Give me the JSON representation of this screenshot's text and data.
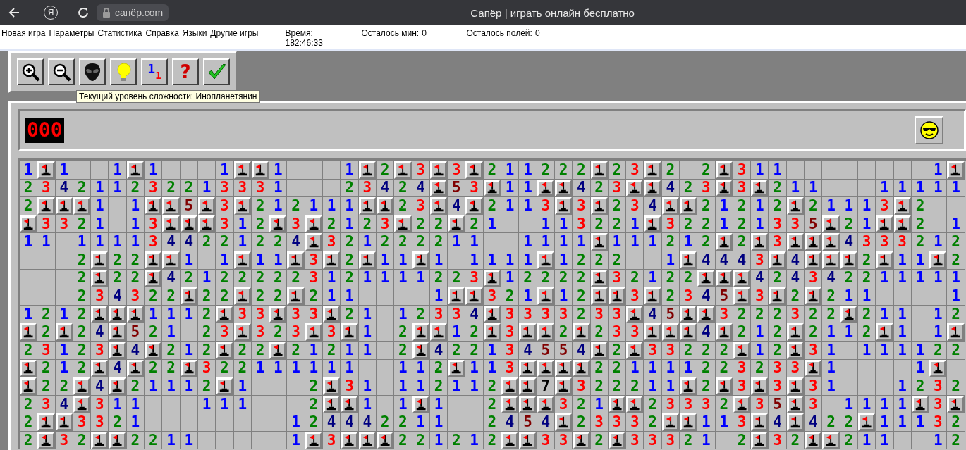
{
  "browser": {
    "logo": "Я",
    "address": "сапёр.com",
    "title": "Сапёр | играть онлайн бесплатно"
  },
  "menu": [
    "Новая игра",
    "Параметры",
    "Статистика",
    "Справка",
    "Языки",
    "Другие игры"
  ],
  "status": [
    {
      "label": "Время:",
      "value": "182:46:33"
    },
    {
      "label": "Осталось мин:",
      "value": "0"
    },
    {
      "label": "Осталось полей:",
      "value": "0"
    }
  ],
  "toolbar": [
    {
      "kind": "zoom-in"
    },
    {
      "kind": "zoom-out"
    },
    {
      "kind": "alien"
    },
    {
      "kind": "bulb"
    },
    {
      "kind": "numbers",
      "glyphs": [
        "1",
        "1"
      ]
    },
    {
      "kind": "help",
      "glyph": "?"
    },
    {
      "kind": "check"
    }
  ],
  "tooltip": "Текущий уровень сложности: Инопланетянин",
  "game": {
    "mine_counter": "000",
    "face": {
      "kind": "sunglasses"
    },
    "rows": [
      [
        "1",
        {
          "kind": "flag"
        },
        "1",
        {
          "kind": "open"
        },
        {
          "kind": "open"
        },
        "1",
        {
          "kind": "flag"
        },
        "1",
        {
          "kind": "open"
        },
        {
          "kind": "open"
        },
        {
          "kind": "open"
        },
        "1",
        {
          "kind": "flag"
        },
        {
          "kind": "flag"
        },
        "1",
        {
          "kind": "open"
        },
        {
          "kind": "open"
        },
        {
          "kind": "open"
        },
        "1",
        {
          "kind": "flag"
        },
        "2",
        {
          "kind": "flag"
        },
        "3",
        {
          "kind": "flag"
        },
        "3",
        {
          "kind": "flag"
        },
        "2",
        "1",
        "1",
        "2",
        "2",
        "2",
        {
          "kind": "flag"
        },
        "2",
        "3",
        {
          "kind": "flag"
        },
        "2",
        {
          "kind": "open"
        },
        "2",
        {
          "kind": "flag"
        },
        "3",
        "1",
        "1",
        {
          "kind": "open"
        },
        {
          "kind": "open"
        },
        {
          "kind": "open"
        },
        {
          "kind": "open"
        },
        {
          "kind": "open"
        },
        {
          "kind": "open"
        },
        {
          "kind": "open"
        },
        {
          "kind": "open"
        },
        "1",
        {
          "kind": "flag"
        }
      ],
      [
        "2",
        "3",
        "4",
        "2",
        "1",
        "1",
        "2",
        "3",
        "2",
        "2",
        "1",
        "3",
        "3",
        "3",
        "1",
        {
          "kind": "open"
        },
        {
          "kind": "open"
        },
        {
          "kind": "open"
        },
        "2",
        "3",
        "4",
        "2",
        "4",
        {
          "kind": "flag"
        },
        "5",
        "3",
        {
          "kind": "flag"
        },
        "1",
        "1",
        {
          "kind": "flag"
        },
        {
          "kind": "flag"
        },
        "4",
        "2",
        "3",
        {
          "kind": "flag"
        },
        {
          "kind": "flag"
        },
        "4",
        "2",
        "3",
        {
          "kind": "flag"
        },
        "3",
        {
          "kind": "flag"
        },
        "2",
        "1",
        "1",
        {
          "kind": "open"
        },
        {
          "kind": "open"
        },
        {
          "kind": "open"
        },
        "1",
        "1",
        "1",
        "1",
        "1"
      ],
      [
        "2",
        {
          "kind": "flag"
        },
        {
          "kind": "flag"
        },
        {
          "kind": "flag"
        },
        "1",
        {
          "kind": "open"
        },
        "1",
        {
          "kind": "flag"
        },
        {
          "kind": "flag"
        },
        "5",
        {
          "kind": "flag"
        },
        "3",
        {
          "kind": "flag"
        },
        "2",
        "1",
        "2",
        "1",
        "1",
        "1",
        {
          "kind": "flag"
        },
        {
          "kind": "flag"
        },
        "2",
        "3",
        {
          "kind": "flag"
        },
        "4",
        {
          "kind": "flag"
        },
        "2",
        "1",
        "1",
        "3",
        {
          "kind": "flag"
        },
        "3",
        {
          "kind": "flag"
        },
        "2",
        "3",
        "4",
        {
          "kind": "flag"
        },
        {
          "kind": "flag"
        },
        "2",
        "1",
        "2",
        "1",
        "2",
        {
          "kind": "flag"
        },
        "2",
        "1",
        "1",
        "1",
        "3",
        {
          "kind": "flag"
        },
        "2",
        {
          "kind": "open"
        },
        {
          "kind": "open"
        }
      ],
      [
        {
          "kind": "flag"
        },
        "3",
        "3",
        "2",
        "1",
        {
          "kind": "open"
        },
        "1",
        "3",
        {
          "kind": "flag"
        },
        {
          "kind": "flag"
        },
        {
          "kind": "flag"
        },
        "3",
        "1",
        "2",
        {
          "kind": "flag"
        },
        "3",
        {
          "kind": "flag"
        },
        "2",
        "1",
        "2",
        "3",
        {
          "kind": "flag"
        },
        "2",
        "2",
        {
          "kind": "flag"
        },
        "2",
        "1",
        {
          "kind": "open"
        },
        {
          "kind": "open"
        },
        "1",
        "1",
        "3",
        "2",
        "2",
        "1",
        {
          "kind": "flag"
        },
        "3",
        "2",
        "2",
        "1",
        "2",
        "1",
        "3",
        "3",
        "5",
        {
          "kind": "flag"
        },
        "2",
        "1",
        {
          "kind": "flag"
        },
        {
          "kind": "flag"
        },
        "2",
        {
          "kind": "open"
        },
        "1"
      ],
      [
        "1",
        "1",
        {
          "kind": "open"
        },
        "1",
        "1",
        "1",
        "1",
        "3",
        "4",
        "4",
        "2",
        "2",
        "1",
        "2",
        "2",
        "4",
        {
          "kind": "flag"
        },
        "3",
        "2",
        "1",
        "2",
        "2",
        "2",
        "2",
        "1",
        "1",
        {
          "kind": "open"
        },
        {
          "kind": "open"
        },
        "1",
        "1",
        "1",
        "1",
        {
          "kind": "flag"
        },
        "1",
        "1",
        "1",
        "2",
        "1",
        "2",
        {
          "kind": "flag"
        },
        "2",
        {
          "kind": "flag"
        },
        "3",
        {
          "kind": "flag"
        },
        {
          "kind": "flag"
        },
        {
          "kind": "flag"
        },
        "4",
        "3",
        "3",
        "3",
        "2",
        "1",
        "2"
      ],
      [
        {
          "kind": "open"
        },
        {
          "kind": "open"
        },
        {
          "kind": "open"
        },
        "2",
        {
          "kind": "flag"
        },
        "2",
        "2",
        {
          "kind": "flag"
        },
        {
          "kind": "flag"
        },
        "1",
        {
          "kind": "open"
        },
        "1",
        {
          "kind": "flag"
        },
        "1",
        "1",
        {
          "kind": "flag"
        },
        "3",
        {
          "kind": "flag"
        },
        "2",
        {
          "kind": "flag"
        },
        "1",
        "1",
        {
          "kind": "flag"
        },
        "1",
        {
          "kind": "open"
        },
        "1",
        "1",
        "1",
        "1",
        {
          "kind": "flag"
        },
        "1",
        "2",
        "2",
        "2",
        {
          "kind": "open"
        },
        {
          "kind": "open"
        },
        "1",
        {
          "kind": "flag"
        },
        "4",
        "4",
        "4",
        "3",
        {
          "kind": "flag"
        },
        "4",
        {
          "kind": "flag"
        },
        {
          "kind": "flag"
        },
        {
          "kind": "flag"
        },
        "2",
        {
          "kind": "flag"
        },
        "1",
        "1",
        {
          "kind": "flag"
        },
        "2"
      ],
      [
        {
          "kind": "open"
        },
        {
          "kind": "open"
        },
        {
          "kind": "open"
        },
        "2",
        {
          "kind": "flag"
        },
        "2",
        "2",
        {
          "kind": "flag"
        },
        "4",
        "2",
        "1",
        "2",
        "2",
        "2",
        "2",
        "2",
        "3",
        "1",
        "2",
        "1",
        "1",
        "1",
        "1",
        "2",
        "2",
        "3",
        {
          "kind": "flag"
        },
        "1",
        "2",
        "2",
        "2",
        "2",
        {
          "kind": "flag"
        },
        "3",
        "2",
        "1",
        "2",
        "2",
        {
          "kind": "flag"
        },
        {
          "kind": "flag"
        },
        {
          "kind": "flag"
        },
        "4",
        "2",
        "4",
        "3",
        "4",
        "2",
        "2",
        "1",
        "1",
        "1",
        "1",
        "1"
      ],
      [
        {
          "kind": "open"
        },
        {
          "kind": "open"
        },
        {
          "kind": "open"
        },
        "2",
        "3",
        "4",
        "3",
        "2",
        "2",
        {
          "kind": "flag"
        },
        "2",
        "2",
        {
          "kind": "flag"
        },
        "2",
        "2",
        {
          "kind": "flag"
        },
        "2",
        "1",
        "1",
        {
          "kind": "open"
        },
        {
          "kind": "open"
        },
        {
          "kind": "open"
        },
        {
          "kind": "open"
        },
        "1",
        {
          "kind": "flag"
        },
        {
          "kind": "flag"
        },
        "3",
        "2",
        "1",
        {
          "kind": "flag"
        },
        "1",
        "2",
        {
          "kind": "flag"
        },
        {
          "kind": "flag"
        },
        "3",
        {
          "kind": "flag"
        },
        "2",
        "3",
        "4",
        "5",
        {
          "kind": "flag"
        },
        "3",
        {
          "kind": "flag"
        },
        "2",
        {
          "kind": "flag"
        },
        "2",
        "1",
        "1",
        {
          "kind": "open"
        },
        {
          "kind": "open"
        },
        {
          "kind": "open"
        },
        {
          "kind": "open"
        },
        "1"
      ],
      [
        "1",
        "2",
        "1",
        "2",
        {
          "kind": "flag"
        },
        {
          "kind": "flag"
        },
        {
          "kind": "flag"
        },
        "1",
        "1",
        "1",
        "2",
        {
          "kind": "flag"
        },
        "3",
        "3",
        {
          "kind": "flag"
        },
        "3",
        "3",
        {
          "kind": "flag"
        },
        "2",
        "1",
        {
          "kind": "open"
        },
        "1",
        "2",
        "3",
        "3",
        "4",
        {
          "kind": "flag"
        },
        "3",
        "3",
        "3",
        "3",
        "2",
        "3",
        "3",
        {
          "kind": "flag"
        },
        "4",
        "5",
        {
          "kind": "flag"
        },
        {
          "kind": "flag"
        },
        "3",
        "2",
        "2",
        "2",
        "3",
        "2",
        "2",
        {
          "kind": "flag"
        },
        "2",
        "1",
        "1",
        {
          "kind": "open"
        },
        "1",
        "2"
      ],
      [
        {
          "kind": "flag"
        },
        "2",
        {
          "kind": "flag"
        },
        "2",
        "4",
        {
          "kind": "flag"
        },
        "5",
        "2",
        "1",
        {
          "kind": "open"
        },
        "2",
        "3",
        {
          "kind": "flag"
        },
        "3",
        "2",
        "3",
        {
          "kind": "flag"
        },
        "3",
        {
          "kind": "flag"
        },
        "1",
        {
          "kind": "open"
        },
        "2",
        {
          "kind": "flag"
        },
        {
          "kind": "flag"
        },
        "1",
        "2",
        {
          "kind": "flag"
        },
        "3",
        {
          "kind": "flag"
        },
        {
          "kind": "flag"
        },
        "2",
        {
          "kind": "flag"
        },
        "2",
        "3",
        "3",
        {
          "kind": "flag"
        },
        {
          "kind": "flag"
        },
        {
          "kind": "flag"
        },
        "4",
        {
          "kind": "flag"
        },
        "2",
        "1",
        "2",
        {
          "kind": "flag"
        },
        "2",
        "1",
        "1",
        "2",
        {
          "kind": "flag"
        },
        "1",
        {
          "kind": "open"
        },
        "1",
        {
          "kind": "flag"
        }
      ],
      [
        "2",
        "3",
        "1",
        "2",
        "3",
        {
          "kind": "flag"
        },
        "4",
        {
          "kind": "flag"
        },
        "2",
        "1",
        "2",
        {
          "kind": "flag"
        },
        "2",
        "2",
        {
          "kind": "flag"
        },
        "2",
        "1",
        "2",
        "1",
        "1",
        {
          "kind": "open"
        },
        "2",
        {
          "kind": "flag"
        },
        "4",
        "2",
        "2",
        "1",
        "3",
        "4",
        "5",
        "5",
        "4",
        {
          "kind": "flag"
        },
        "2",
        {
          "kind": "flag"
        },
        "3",
        "3",
        "2",
        "2",
        "2",
        {
          "kind": "flag"
        },
        "1",
        "2",
        {
          "kind": "flag"
        },
        "3",
        "1",
        {
          "kind": "open"
        },
        "1",
        "1",
        "1",
        "1",
        "2",
        "2"
      ],
      [
        {
          "kind": "flag"
        },
        "2",
        "1",
        "2",
        {
          "kind": "flag"
        },
        "4",
        {
          "kind": "flag"
        },
        "2",
        "2",
        {
          "kind": "flag"
        },
        "3",
        "2",
        "2",
        "1",
        "1",
        "1",
        "1",
        "1",
        "1",
        {
          "kind": "open"
        },
        {
          "kind": "open"
        },
        "1",
        "1",
        "2",
        {
          "kind": "flag"
        },
        "1",
        "1",
        "3",
        {
          "kind": "flag"
        },
        {
          "kind": "flag"
        },
        {
          "kind": "flag"
        },
        {
          "kind": "flag"
        },
        "2",
        "2",
        "1",
        "1",
        "1",
        "1",
        "2",
        "2",
        "3",
        "2",
        "3",
        "3",
        {
          "kind": "flag"
        },
        "1",
        {
          "kind": "open"
        },
        {
          "kind": "open"
        },
        {
          "kind": "open"
        },
        {
          "kind": "open"
        },
        "1",
        {
          "kind": "flag"
        },
        {
          "kind": "open"
        }
      ],
      [
        {
          "kind": "flag"
        },
        "2",
        "2",
        {
          "kind": "flag"
        },
        "4",
        {
          "kind": "flag"
        },
        "2",
        "1",
        "1",
        "1",
        "2",
        {
          "kind": "flag"
        },
        "1",
        {
          "kind": "open"
        },
        {
          "kind": "open"
        },
        {
          "kind": "open"
        },
        "2",
        {
          "kind": "flag"
        },
        "3",
        "1",
        {
          "kind": "open"
        },
        "1",
        "1",
        "2",
        "1",
        "1",
        "2",
        {
          "kind": "flag"
        },
        {
          "kind": "flag"
        },
        "7",
        {
          "kind": "flag"
        },
        "3",
        "2",
        "2",
        "2",
        "1",
        "1",
        {
          "kind": "flag"
        },
        "2",
        {
          "kind": "flag"
        },
        "3",
        {
          "kind": "flag"
        },
        "3",
        {
          "kind": "flag"
        },
        "3",
        "1",
        {
          "kind": "open"
        },
        {
          "kind": "open"
        },
        {
          "kind": "open"
        },
        "1",
        "2",
        "3",
        "2"
      ],
      [
        "2",
        "3",
        "4",
        {
          "kind": "flag"
        },
        "3",
        "1",
        "1",
        {
          "kind": "open"
        },
        {
          "kind": "open"
        },
        {
          "kind": "open"
        },
        "1",
        "1",
        "1",
        {
          "kind": "open"
        },
        {
          "kind": "open"
        },
        {
          "kind": "open"
        },
        "2",
        {
          "kind": "flag"
        },
        {
          "kind": "flag"
        },
        "1",
        {
          "kind": "open"
        },
        "1",
        {
          "kind": "flag"
        },
        "1",
        {
          "kind": "open"
        },
        {
          "kind": "open"
        },
        "2",
        {
          "kind": "flag"
        },
        {
          "kind": "flag"
        },
        {
          "kind": "flag"
        },
        "3",
        "2",
        "1",
        {
          "kind": "flag"
        },
        {
          "kind": "flag"
        },
        "2",
        "3",
        "3",
        "3",
        "2",
        {
          "kind": "flag"
        },
        "3",
        "5",
        {
          "kind": "flag"
        },
        "3",
        {
          "kind": "open"
        },
        "1",
        "1",
        "1",
        "1",
        {
          "kind": "flag"
        },
        "3",
        {
          "kind": "flag"
        }
      ],
      [
        "2",
        {
          "kind": "flag"
        },
        {
          "kind": "flag"
        },
        "3",
        "3",
        "2",
        "1",
        {
          "kind": "open"
        },
        {
          "kind": "open"
        },
        {
          "kind": "open"
        },
        {
          "kind": "open"
        },
        {
          "kind": "open"
        },
        {
          "kind": "open"
        },
        {
          "kind": "open"
        },
        {
          "kind": "open"
        },
        "1",
        "2",
        "4",
        "4",
        "4",
        "2",
        "2",
        "1",
        "1",
        {
          "kind": "open"
        },
        {
          "kind": "open"
        },
        "2",
        "4",
        "5",
        "4",
        {
          "kind": "flag"
        },
        "2",
        "3",
        "3",
        "3",
        "2",
        {
          "kind": "flag"
        },
        {
          "kind": "flag"
        },
        "1",
        "1",
        "3",
        {
          "kind": "flag"
        },
        "4",
        {
          "kind": "flag"
        },
        "4",
        "2",
        "2",
        {
          "kind": "flag"
        },
        "1",
        "1",
        "1",
        "3",
        "2"
      ],
      [
        "2",
        {
          "kind": "flag"
        },
        "3",
        "2",
        {
          "kind": "flag"
        },
        {
          "kind": "flag"
        },
        "2",
        "2",
        "1",
        "1",
        {
          "kind": "open"
        },
        {
          "kind": "open"
        },
        {
          "kind": "open"
        },
        {
          "kind": "open"
        },
        {
          "kind": "open"
        },
        "1",
        {
          "kind": "flag"
        },
        "3",
        {
          "kind": "flag"
        },
        {
          "kind": "flag"
        },
        {
          "kind": "flag"
        },
        "2",
        "2",
        "1",
        "2",
        "1",
        "2",
        {
          "kind": "flag"
        },
        {
          "kind": "flag"
        },
        "3",
        "3",
        {
          "kind": "flag"
        },
        "2",
        {
          "kind": "flag"
        },
        "3",
        "3",
        "3",
        "2",
        "1",
        {
          "kind": "open"
        },
        "2",
        {
          "kind": "flag"
        },
        "3",
        "2",
        {
          "kind": "flag"
        },
        {
          "kind": "flag"
        },
        "2",
        "1",
        "1",
        {
          "kind": "open"
        },
        {
          "kind": "open"
        },
        "1",
        "2"
      ]
    ]
  }
}
